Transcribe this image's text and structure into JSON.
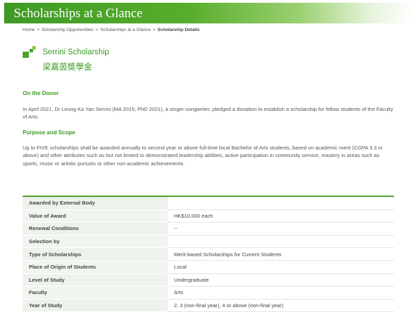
{
  "banner": {
    "title": "Scholarships at a Glance"
  },
  "breadcrumb": {
    "items": [
      "Home",
      "Scholarship Opportunities",
      "Scholarships at a Glance"
    ],
    "current": "Scholarship Details",
    "separator": ">"
  },
  "scholarship": {
    "name_en": "Serrini Scholarship",
    "name_zh": "梁嘉茵獎學金"
  },
  "sections": [
    {
      "heading": "On the Donor",
      "text": "In April 2021, Dr Leung Ka Yan Serrini (MA 2015; PhD 2021), a singer-songwriter, pledged a donation to establish a scholarship for fellow students of the Faculty of Arts."
    },
    {
      "heading": "Purpose and Scope",
      "text": "Up to FIVE scholarships shall be awarded annually to second year or above full-time local Bachelor of Arts students, based on academic merit (CGPA 3.3 or above) and other attributes such as but not limited to demonstrated leadership abilities, active participation in community service, mastery in areas such as sports, music or artistic pursuits or other non-academic achievements."
    }
  ],
  "details": [
    {
      "label": "Awarded by External Body",
      "value": ""
    },
    {
      "label": "Value of Award",
      "value": "HK$10,000 each"
    },
    {
      "label": "Renewal Conditions",
      "value": "--"
    },
    {
      "label": "Selection by",
      "value": ""
    },
    {
      "label": "Type of Scholarships",
      "value": "Merit-based Scholarships for Current Students"
    },
    {
      "label": "Place of Origin of Students",
      "value": "Local"
    },
    {
      "label": "Level of Study",
      "value": "Undergraduate"
    },
    {
      "label": "Faculty",
      "value": "Arts"
    },
    {
      "label": "Year of Study",
      "value": "2, 3 (non-final year), 4 or above (non-final year)"
    }
  ],
  "colors": {
    "accent": "#4aa128",
    "heading": "#3a9a22",
    "label_bg": "#f1f5ef"
  },
  "icons": {
    "logo": "green-squares-logo"
  }
}
